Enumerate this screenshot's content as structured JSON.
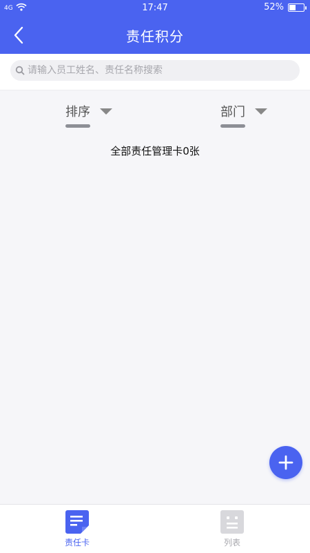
{
  "status_bar": {
    "network": "4G",
    "time": "17:47",
    "battery": "52%",
    "battery_level": 0.52
  },
  "header": {
    "title": "责任积分"
  },
  "search": {
    "placeholder": "请输入员工姓名、责任名称搜索"
  },
  "filters": {
    "sort_label": "排序",
    "department_label": "部门"
  },
  "summary": "全部责任管理卡0张",
  "tabs": [
    {
      "label": "责任卡",
      "active": true
    },
    {
      "label": "列表",
      "active": false
    }
  ],
  "colors": {
    "primary": "#4a63f0",
    "tab_active": "#4a63f0",
    "tab_inactive": "#a8a8ae",
    "background": "#f6f6f9"
  },
  "icons": {
    "back": "chevron-left-icon",
    "search": "search-icon",
    "dropdown": "triangle-down-icon",
    "add": "plus-icon",
    "card": "document-card-icon",
    "list": "list-icon"
  }
}
